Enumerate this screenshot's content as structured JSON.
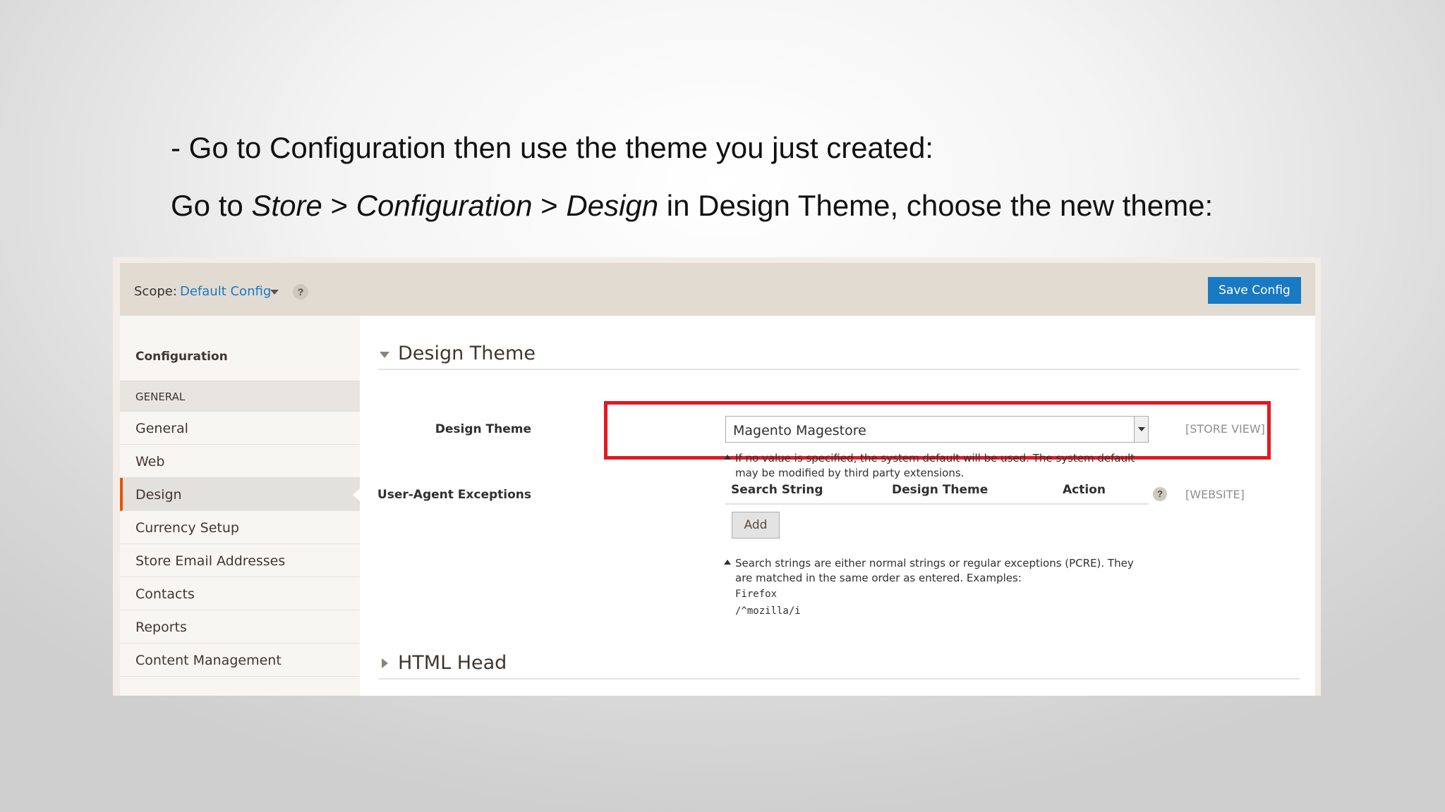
{
  "slide": {
    "line1": "- Go to Configuration then use the theme you just created:",
    "line2_prefix": "Go to ",
    "line2_store": "Store",
    "line2_sep1": " > ",
    "line2_configuration": "Configuration",
    "line2_sep2": " > ",
    "line2_design": "Design",
    "line2_suffix": " in Design Theme, choose the new theme:"
  },
  "scope": {
    "label": "Scope:",
    "value": "Default Config",
    "help": "?",
    "save_button": "Save Config"
  },
  "sidebar": {
    "title": "Configuration",
    "group": "GENERAL",
    "items": [
      {
        "label": "General"
      },
      {
        "label": "Web"
      },
      {
        "label": "Design",
        "active": true
      },
      {
        "label": "Currency Setup"
      },
      {
        "label": "Store Email Addresses"
      },
      {
        "label": "Contacts"
      },
      {
        "label": "Reports"
      },
      {
        "label": "Content Management"
      }
    ]
  },
  "design_theme_section": {
    "title": "Design Theme",
    "field_label": "Design Theme",
    "selected_value": "Magento Magestore",
    "scope_note": "[STORE VIEW]",
    "note_line1": "If no value is specified, the system default will be used. The system default",
    "note_line2": "may be modified by third party extensions."
  },
  "user_agent": {
    "label": "User-Agent Exceptions",
    "columns": [
      "Search String",
      "Design Theme",
      "Action"
    ],
    "help": "?",
    "scope_note": "[WEBSITE]",
    "add_button": "Add",
    "note_line1": "Search strings are either normal strings or regular exceptions (PCRE). They",
    "note_line2": "are matched in the same order as entered. Examples:",
    "example1": "Firefox",
    "example2": "/^mozilla/i"
  },
  "html_head_section": {
    "title": "HTML Head"
  },
  "colors": {
    "accent_blue": "#1979c3",
    "highlight_red": "#e01a24",
    "active_orange": "#eb5202"
  }
}
